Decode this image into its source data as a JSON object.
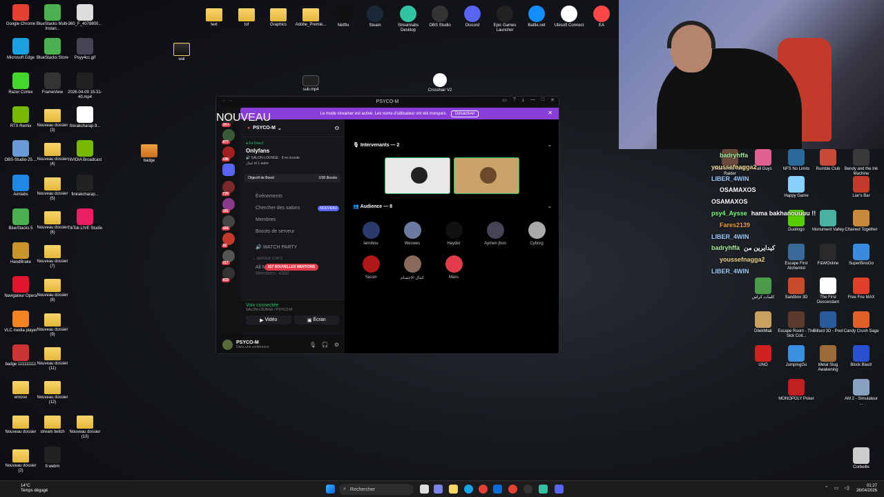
{
  "desktop_left": [
    {
      "label": "Google Chrome",
      "icon": "chrome-icon",
      "color": "#e34133"
    },
    {
      "label": "BlueStacks Multi-Instan...",
      "icon": "bluestacks-icon",
      "color": "#4caf50"
    },
    {
      "label": "360_F_4078800...",
      "icon": "image-file-icon",
      "color": "#ddd"
    },
    {
      "label": "Microsoft Edge",
      "icon": "edge-icon",
      "color": "#1aa1e2"
    },
    {
      "label": "BlueStacks Store",
      "icon": "bluestacks-store-icon",
      "color": "#4caf50"
    },
    {
      "label": "Psyy4cc.gif",
      "icon": "gif-file-icon",
      "color": "#445"
    },
    {
      "label": "Razer Cortex",
      "icon": "razer-icon",
      "color": "#44d62c"
    },
    {
      "label": "FrameView",
      "icon": "frameview-icon",
      "color": "#333"
    },
    {
      "label": "2026-04-09 15-31-40.mp4",
      "icon": "video-file-icon",
      "color": "#222"
    },
    {
      "label": "RTX Remix",
      "icon": "rtx-remix-icon",
      "color": "#76b900"
    },
    {
      "label": "Nouveau dossier (3)",
      "icon": "folder-icon",
      "color": "folder"
    },
    {
      "label": "finirakcharap.9...",
      "icon": "file-icon",
      "color": "#fff"
    },
    {
      "label": "OBS-Studio-25....",
      "icon": "obs-icon",
      "color": "#6a9ad4"
    },
    {
      "label": "Nouveau dossier (4)",
      "icon": "folder-icon",
      "color": "folder"
    },
    {
      "label": "NVIDIA Broadcast",
      "icon": "nvidia-broadcast-icon",
      "color": "#76b900"
    },
    {
      "label": "Aimlabs",
      "icon": "aimlabs-icon",
      "color": "#1e88e5"
    },
    {
      "label": "Nouveau dossier (5)",
      "icon": "folder-icon",
      "color": "folder"
    },
    {
      "label": "finirakcharap...",
      "icon": "video-file-icon",
      "color": "#222"
    },
    {
      "label": "BlueStacks 5",
      "icon": "bluestacks5-icon",
      "color": "#4caf50"
    },
    {
      "label": "Nouveau dossier (6)",
      "icon": "folder-icon",
      "color": "folder"
    },
    {
      "label": "TikTok LIVE Studio",
      "icon": "tiktok-icon",
      "color": "#e91e63"
    },
    {
      "label": "HandBrake",
      "icon": "handbrake-icon",
      "color": "#c8952b"
    },
    {
      "label": "Nouveau dossier (7)",
      "icon": "folder-icon",
      "color": "folder"
    },
    {
      "label": "Navigateur Opera",
      "icon": "opera-icon",
      "color": "#e3142d"
    },
    {
      "label": "Nouveau dossier (8)",
      "icon": "folder-icon",
      "color": "folder"
    },
    {
      "label": "VLC media player",
      "icon": "vlc-icon",
      "color": "#f58220"
    },
    {
      "label": "Nouveau dossier (9)",
      "icon": "folder-icon",
      "color": "folder"
    },
    {
      "label": "badge 111111111",
      "icon": "image-file-icon",
      "color": "#c33"
    },
    {
      "label": "Nouveau dossier (11)",
      "icon": "folder-icon",
      "color": "folder"
    },
    {
      "label": "emooo",
      "icon": "folder-icon",
      "color": "folder"
    },
    {
      "label": "Nouveau dossier (12)",
      "icon": "folder-icon",
      "color": "folder"
    },
    {
      "label": "Nouveau dossier",
      "icon": "folder-icon",
      "color": "folder"
    },
    {
      "label": "stream twitch",
      "icon": "folder-icon",
      "color": "folder"
    },
    {
      "label": "Nouveau dossier (13)",
      "icon": "folder-icon",
      "color": "folder"
    },
    {
      "label": "Nouveau dossier (2)",
      "icon": "folder-icon",
      "color": "folder"
    },
    {
      "label": "9.webm",
      "icon": "video-file-icon",
      "color": "#222"
    }
  ],
  "desktop_top": [
    {
      "label": "text",
      "icon": "folder-icon"
    },
    {
      "label": "tof",
      "icon": "folder-icon"
    },
    {
      "label": "Graphics",
      "icon": "folder-icon"
    },
    {
      "label": "Adobe_Premie...",
      "icon": "folder-icon"
    },
    {
      "label": "Netflix",
      "icon": "netflix-icon"
    },
    {
      "label": "Steam",
      "icon": "steam-icon"
    },
    {
      "label": "Streamlabs Desktop",
      "icon": "streamlabs-icon"
    },
    {
      "label": "OBS Studio",
      "icon": "obs-icon"
    },
    {
      "label": "Discord",
      "icon": "discord-icon"
    },
    {
      "label": "Epic Games Launcher",
      "icon": "epic-icon"
    },
    {
      "label": "Battle.net",
      "icon": "battlenet-icon"
    },
    {
      "label": "Ubisoft Connect",
      "icon": "ubisoft-icon"
    },
    {
      "label": "EA",
      "icon": "ea-icon"
    }
  ],
  "desktop_misc": {
    "wal": "wal",
    "badge": "badge",
    "sub": "sub.mp4",
    "crosshair": "Crosshair V2"
  },
  "desktop_right": [
    {
      "label": "Rise of the Tomb Raider"
    },
    {
      "label": "Fall Guys"
    },
    {
      "label": "NFS No Limits"
    },
    {
      "label": "Rumble Club"
    },
    {
      "label": "Bendy and the Ink Machine"
    },
    {
      "label": "Happy Game"
    },
    {
      "label": "Liar's Bar"
    },
    {
      "label": "Duolingo"
    },
    {
      "label": "Monument Valley"
    },
    {
      "label": "Chained Together"
    },
    {
      "label": "Escape First Alchemist"
    },
    {
      "label": "F&WOnline"
    },
    {
      "label": "SuperBinoGo"
    },
    {
      "label": "كلمات كراش"
    },
    {
      "label": "Sandbox 3D"
    },
    {
      "label": "The First Descendant"
    },
    {
      "label": "Free Fire MAX"
    },
    {
      "label": "DilekMlak"
    },
    {
      "label": "Escape Room - The Sick Coll..."
    },
    {
      "label": "Billard 3D - Pool"
    },
    {
      "label": "Candy Crush Saga"
    },
    {
      "label": "UNO"
    },
    {
      "label": "JumpingGo"
    },
    {
      "label": "Metal Slug Awakening"
    },
    {
      "label": "Block Blast!"
    },
    {
      "label": "MONOPOLY Poker"
    },
    {
      "label": "AM 2 - Simulateur ..."
    },
    {
      "label": "Corbeille"
    }
  ],
  "discord": {
    "window_title": "PSYCO-M",
    "banner_text": "Le mode streamer est activé. Les noms d'utilisateur ont été tronqués.",
    "banner_button": "Désactiver",
    "server_name": "PSYCO-M",
    "live_tag": "En Direct",
    "live_title": "Onlyfans",
    "live_channel": "SALON-LOUNGE",
    "live_listening": "8 en écoute",
    "live_others": "كمال et 1 autre",
    "boost_label": "Objectif de Boost",
    "boost_value": "2/30 Boosts",
    "menu": [
      {
        "label": "Événements"
      },
      {
        "label": "Chercher des salons",
        "tag": "NOUVEAU"
      },
      {
        "label": "Membres"
      },
      {
        "label": "Boosts de serveur"
      }
    ],
    "watch_party": "WATCH PARTY",
    "server_stats": "SERVER STATS",
    "all_members": "All Members: 5016",
    "members_partial": "Members: 4980",
    "mentions_badge": "817 NOUVELLES MENTIONS",
    "rail_new": "NOUVEAU",
    "rail_badges": [
      "1K+",
      "877",
      "196",
      "729",
      "181",
      "164",
      "32",
      "317",
      "833"
    ],
    "voice_connected": "Voix connectée",
    "voice_channel": "SALON-LOUNGE / PSYCO-M",
    "video_btn": "Vidéo",
    "screen_btn": "Écran",
    "user_name": "PSYCO-M",
    "user_status": "Dans une conférence",
    "speakers_header": "Intervenants — 2",
    "audience_header": "Audience — 8",
    "audience": [
      {
        "name": "larnibou",
        "color": "#2a3a6a"
      },
      {
        "name": "Weswes",
        "color": "#6a7aa0"
      },
      {
        "name": "Hayder",
        "color": "#111"
      },
      {
        "name": "Aymen jhon",
        "color": "#445"
      },
      {
        "name": "Cyborg",
        "color": "#aaa"
      },
      {
        "name": "Yassin",
        "color": "#b01818"
      },
      {
        "name": "كمال الاجسام",
        "color": "#8a6a5a"
      },
      {
        "name": "Maru",
        "color": "#e23b4a"
      }
    ]
  },
  "chat_overlay": [
    {
      "user": "badryhffa",
      "color": "#a8f0a0"
    },
    {
      "user": "youssefnagga2",
      "color": "#f0d890"
    },
    {
      "user": "LIBER_4WIN",
      "color": "#a0d0ff"
    },
    {
      "user": "OSAMAXOS",
      "color": "#ffffff"
    },
    {
      "user": "OSAMAXOS",
      "color": "#ffffff"
    },
    {
      "user": "psy4_Aysse",
      "color": "#80ff80",
      "msg": "hama bakhanouuuu !!"
    },
    {
      "user": "Fares2139",
      "color": "#f0a040"
    },
    {
      "user": "LIBER_4WIN",
      "color": "#a0d0ff"
    },
    {
      "user": "badryhffa",
      "color": "#a8f0a0",
      "msg": "كيدايرين من"
    },
    {
      "user": "youssefnagga2",
      "color": "#f0d890"
    },
    {
      "user": "LIBER_4WIN",
      "color": "#a0d0ff"
    }
  ],
  "taskbar": {
    "temperature": "14°C",
    "weather_desc": "Temps dégagé",
    "search_placeholder": "Rechercher",
    "time": "01:27",
    "date": "26/04/2026"
  }
}
